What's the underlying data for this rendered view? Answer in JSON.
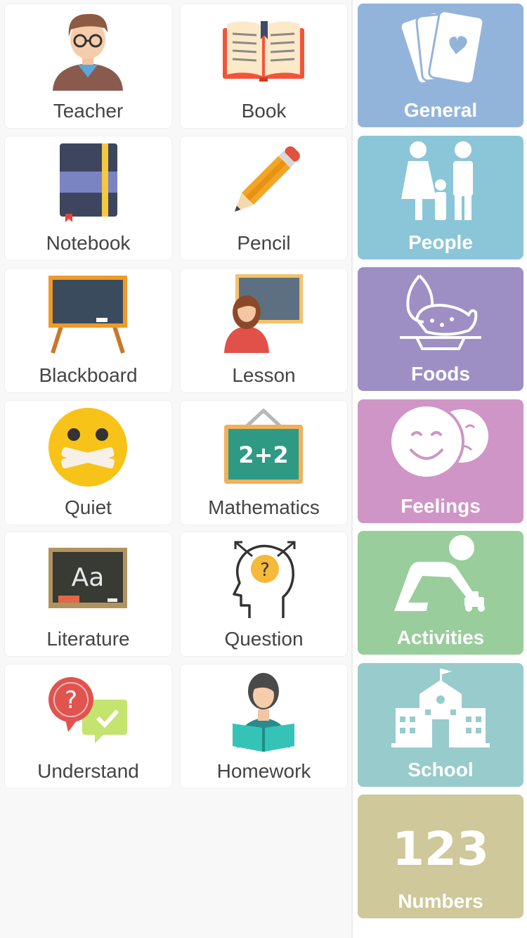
{
  "items": [
    {
      "label": "Teacher",
      "icon": "teacher-icon"
    },
    {
      "label": "Book",
      "icon": "book-icon"
    },
    {
      "label": "Notebook",
      "icon": "notebook-icon"
    },
    {
      "label": "Pencil",
      "icon": "pencil-icon"
    },
    {
      "label": "Blackboard",
      "icon": "blackboard-icon"
    },
    {
      "label": "Lesson",
      "icon": "lesson-icon"
    },
    {
      "label": "Quiet",
      "icon": "quiet-icon"
    },
    {
      "label": "Mathematics",
      "icon": "mathematics-icon",
      "board_text": "2+2"
    },
    {
      "label": "Literature",
      "icon": "literature-icon",
      "board_text": "Aa"
    },
    {
      "label": "Question",
      "icon": "question-icon",
      "mark": "?"
    },
    {
      "label": "Understand",
      "icon": "understand-icon",
      "mark": "?"
    },
    {
      "label": "Homework",
      "icon": "homework-icon"
    }
  ],
  "categories": [
    {
      "label": "General",
      "icon": "cards-icon",
      "color": "#93b4da"
    },
    {
      "label": "People",
      "icon": "family-icon",
      "color": "#8ac6d8"
    },
    {
      "label": "Foods",
      "icon": "food-icon",
      "color": "#9d8fc4"
    },
    {
      "label": "Feelings",
      "icon": "masks-icon",
      "color": "#cf95c6"
    },
    {
      "label": "Activities",
      "icon": "play-icon",
      "color": "#99cd9c"
    },
    {
      "label": "School",
      "icon": "school-icon",
      "color": "#98cbcb"
    },
    {
      "label": "Numbers",
      "icon": "numbers-icon",
      "color": "#cec89a",
      "number_text": "123"
    }
  ]
}
